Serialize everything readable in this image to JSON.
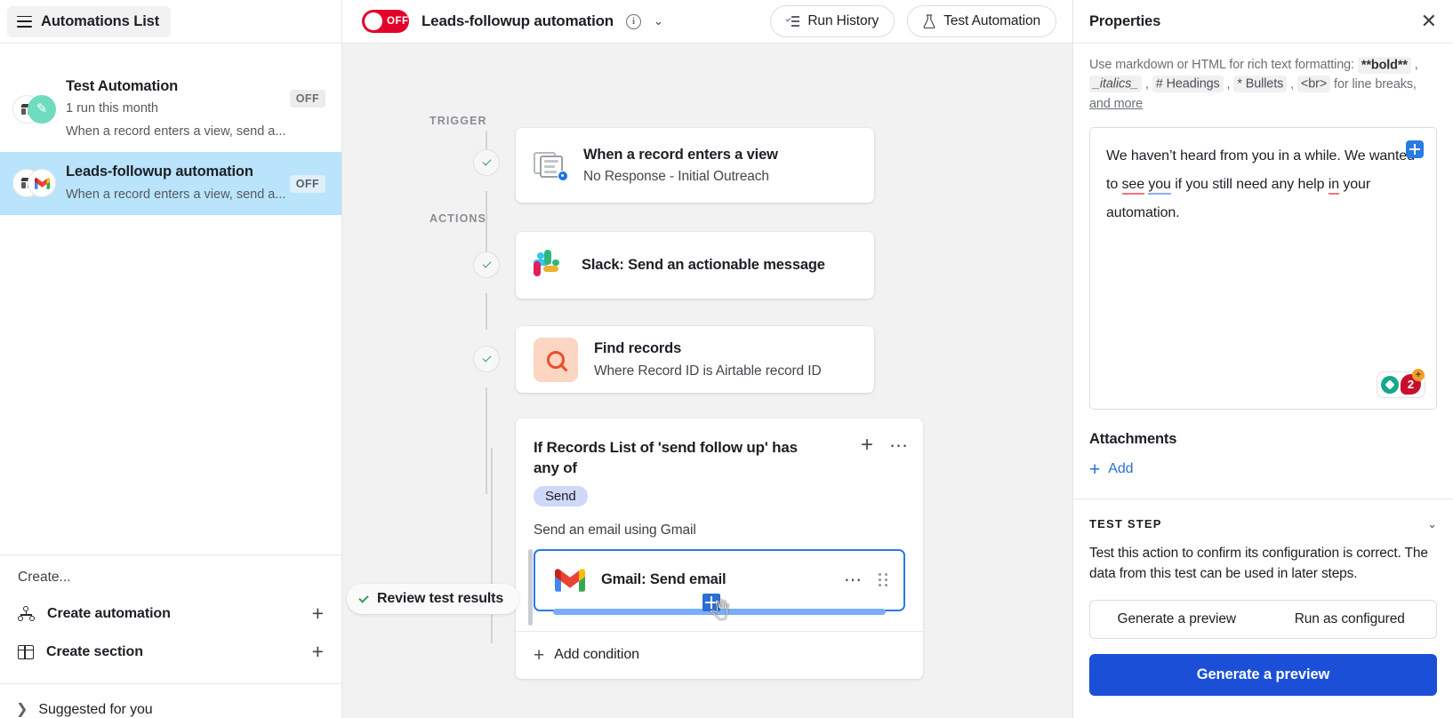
{
  "sidebar": {
    "header_button": "Automations List",
    "automations": [
      {
        "name": "Test Automation",
        "runs": "1 run this month",
        "description": "When a record enters a view, send a...",
        "status": "OFF",
        "icon": "pencil-icon",
        "selected": false
      },
      {
        "name": "Leads-followup automation",
        "runs": "",
        "description": "When a record enters a view, send a...",
        "status": "OFF",
        "icon": "gmail-icon",
        "selected": true
      }
    ],
    "create_label": "Create...",
    "create_items": [
      {
        "label": "Create automation",
        "icon": "nodes-icon"
      },
      {
        "label": "Create section",
        "icon": "grid-icon"
      }
    ],
    "suggested_label": "Suggested for you"
  },
  "header": {
    "toggle_state": "OFF",
    "automation_name": "Leads-followup automation",
    "info_icon": "info-icon",
    "chevron_icon": "chevron-down-icon",
    "run_history": "Run History",
    "test_automation": "Test Automation"
  },
  "flow": {
    "trigger_label": "TRIGGER",
    "actions_label": "ACTIONS",
    "trigger": {
      "title": "When a record enters a view",
      "subtitle": "No Response - Initial Outreach",
      "icon": "view-record-icon",
      "status": "complete"
    },
    "actions": [
      {
        "title": "Slack: Send an actionable message",
        "subtitle": "",
        "icon": "slack-icon",
        "status": "complete"
      },
      {
        "title": "Find records",
        "subtitle": "Where Record ID is Airtable record ID",
        "icon": "search-icon",
        "status": "complete"
      }
    ],
    "condition": {
      "title": "If Records List of 'send follow up' has any of",
      "chip": "Send",
      "subtitle": "Send an email using Gmail",
      "nested_action": {
        "title": "Gmail: Send email",
        "icon": "gmail-icon",
        "more_icon": "more-horizontal-icon",
        "drag_icon": "drag-handle-icon"
      },
      "add_condition": "Add condition"
    },
    "review_pill": "Review test results"
  },
  "properties": {
    "title": "Properties",
    "close_icon": "close-icon",
    "hint": {
      "prefix": "Use markdown or HTML for rich text formatting:",
      "bold": "**bold**",
      "italics": "_italics_",
      "headings": "# Headings",
      "bullets": "* Bullets",
      "br": "<br>",
      "mid": "for line breaks,",
      "link": "and more"
    },
    "editor": {
      "line1_a": "We haven’t heard from you in a while. We wanted",
      "line2_a": "to ",
      "line2_red1": "see",
      "line2_mid": " ",
      "line2_blue": "you",
      "line2_b": " if you still need any help ",
      "line2_red2": "in",
      "line2_c": " your",
      "line3": "automation.",
      "insert_icon": "blue-plus-icon"
    },
    "grammarly": {
      "bulb_icon": "grammarly-bulb-icon",
      "count": "2",
      "plus": "+"
    },
    "attachments_title": "Attachments",
    "attachments_add": "Add",
    "test_step": {
      "title": "TEST STEP",
      "collapse_icon": "chevron-down-icon",
      "description": "Test this action to confirm its configuration is correct. The data from this test can be used in later steps.",
      "segment_options": [
        "Generate a preview",
        "Run as configured"
      ],
      "primary_button": "Generate a preview"
    }
  },
  "colors": {
    "accent_blue": "#1b4fd8",
    "toggle_red": "#e3002b",
    "selected_row": "#b9e4fb",
    "canvas_bg": "#f2f2f2",
    "check_green": "#2f9e63"
  }
}
